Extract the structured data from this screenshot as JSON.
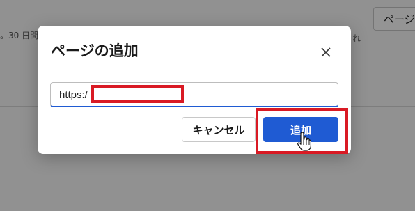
{
  "background": {
    "left_text": "。30 日間",
    "right_text": "れ",
    "button_label": "ページ"
  },
  "dialog": {
    "title": "ページの追加",
    "close_icon": "close-icon",
    "url_input": {
      "value": "https:/",
      "placeholder": ""
    },
    "cancel_label": "キャンセル",
    "add_label": "追加"
  },
  "annotations": {
    "color": "#d91a24"
  },
  "colors": {
    "primary": "#1f5bd3",
    "annotation": "#d91a24"
  }
}
